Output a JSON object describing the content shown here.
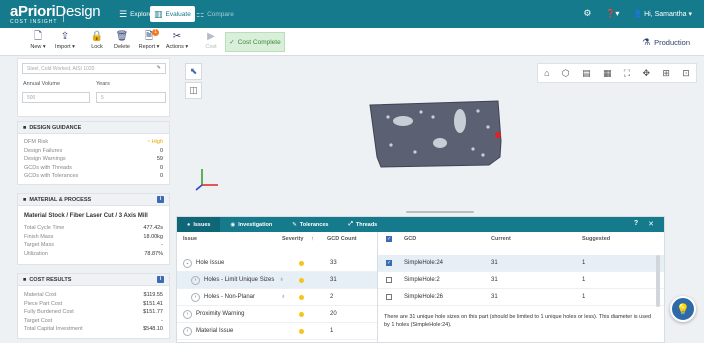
{
  "app": {
    "logo_bold": "aPriori",
    "logo_light": "Design",
    "logo_sub": "COST INSIGHT"
  },
  "nav": {
    "tabs": [
      {
        "label": "Explore",
        "icon": "grid-icon"
      },
      {
        "label": "Evaluate",
        "icon": "chart-icon"
      },
      {
        "label": "Compare",
        "icon": "compare-icon"
      }
    ],
    "active": "Evaluate",
    "user": "Hi, Samantha"
  },
  "toolbar": {
    "new": "New",
    "import": "Import",
    "lock": "Lock",
    "delete": "Delete",
    "report": "Report",
    "report_badge": "1",
    "actions": "Actions",
    "cost": "Cost",
    "cost_complete": "Cost Complete",
    "production": "Production"
  },
  "left": {
    "search_placeholder": "Steel, Cold Worked, AISI 1020",
    "annual_volume_label": "Annual Volume",
    "years_label": "Years",
    "annual_volume_value": "500",
    "years_value": "5",
    "design_guidance": {
      "title": "DESIGN GUIDANCE",
      "rows": [
        {
          "label": "DFM Risk",
          "value": "High"
        },
        {
          "label": "Design Failures",
          "value": "0"
        },
        {
          "label": "Design Warnings",
          "value": "59"
        },
        {
          "label": "GCDs with Threads",
          "value": "0"
        },
        {
          "label": "GCDs with Tolerances",
          "value": "0"
        }
      ]
    },
    "material_process": {
      "title": "MATERIAL & PROCESS",
      "subtitle": "Material Stock / Fiber Laser Cut / 3 Axis Mill",
      "rows": [
        {
          "label": "Total Cycle Time",
          "value": "477.42s"
        },
        {
          "label": "Finish Mass",
          "value": "18.00kg"
        },
        {
          "label": "Target Mass",
          "value": "-"
        },
        {
          "label": "Utilization",
          "value": "78.87%"
        }
      ]
    },
    "cost_results": {
      "title": "COST RESULTS",
      "rows": [
        {
          "label": "Material Cost",
          "value": "$119.55"
        },
        {
          "label": "Piece Part Cost",
          "value": "$151.41"
        },
        {
          "label": "Fully Burdened Cost",
          "value": "$151.77"
        },
        {
          "label": "Target Cost",
          "value": "-"
        },
        {
          "label": "Total Capital Investment",
          "value": "$548.10"
        }
      ]
    }
  },
  "panel": {
    "tabs": [
      "Issues",
      "Investigation",
      "Tolerances",
      "Threads"
    ],
    "active_tab": "Issues",
    "left_headers": {
      "issue": "Issue",
      "severity": "Severity",
      "count": "GCD Count"
    },
    "issues": [
      {
        "label": "Hole Issue",
        "count": "33",
        "indent": 0,
        "selected": false
      },
      {
        "label": "Holes - Limit Unique Sizes",
        "count": "31",
        "indent": 1,
        "selected": true
      },
      {
        "label": "Holes - Non-Planar",
        "count": "2",
        "indent": 1,
        "selected": false
      },
      {
        "label": "Proximity Warning",
        "count": "20",
        "indent": 0,
        "selected": false
      },
      {
        "label": "Material Issue",
        "count": "1",
        "indent": 0,
        "selected": false
      }
    ],
    "right_headers": {
      "gcd": "GCD",
      "current": "Current",
      "suggested": "Suggested"
    },
    "gcds": [
      {
        "name": "SimpleHole:24",
        "current": "31",
        "suggested": "1",
        "checked": true
      },
      {
        "name": "SimpleHole:2",
        "current": "31",
        "suggested": "1",
        "checked": false
      },
      {
        "name": "SimpleHole:26",
        "current": "31",
        "suggested": "1",
        "checked": false
      }
    ],
    "note": "There are 31 unique hole sizes on this part (should be limited to 1 unique holes or less). This diameter is used by 1 holes (SimpleHole:24)."
  },
  "colors": {
    "brand": "#147a8c",
    "accent": "#3d6ab5",
    "warning": "#f5c518",
    "success_bg": "#d9efd9"
  }
}
